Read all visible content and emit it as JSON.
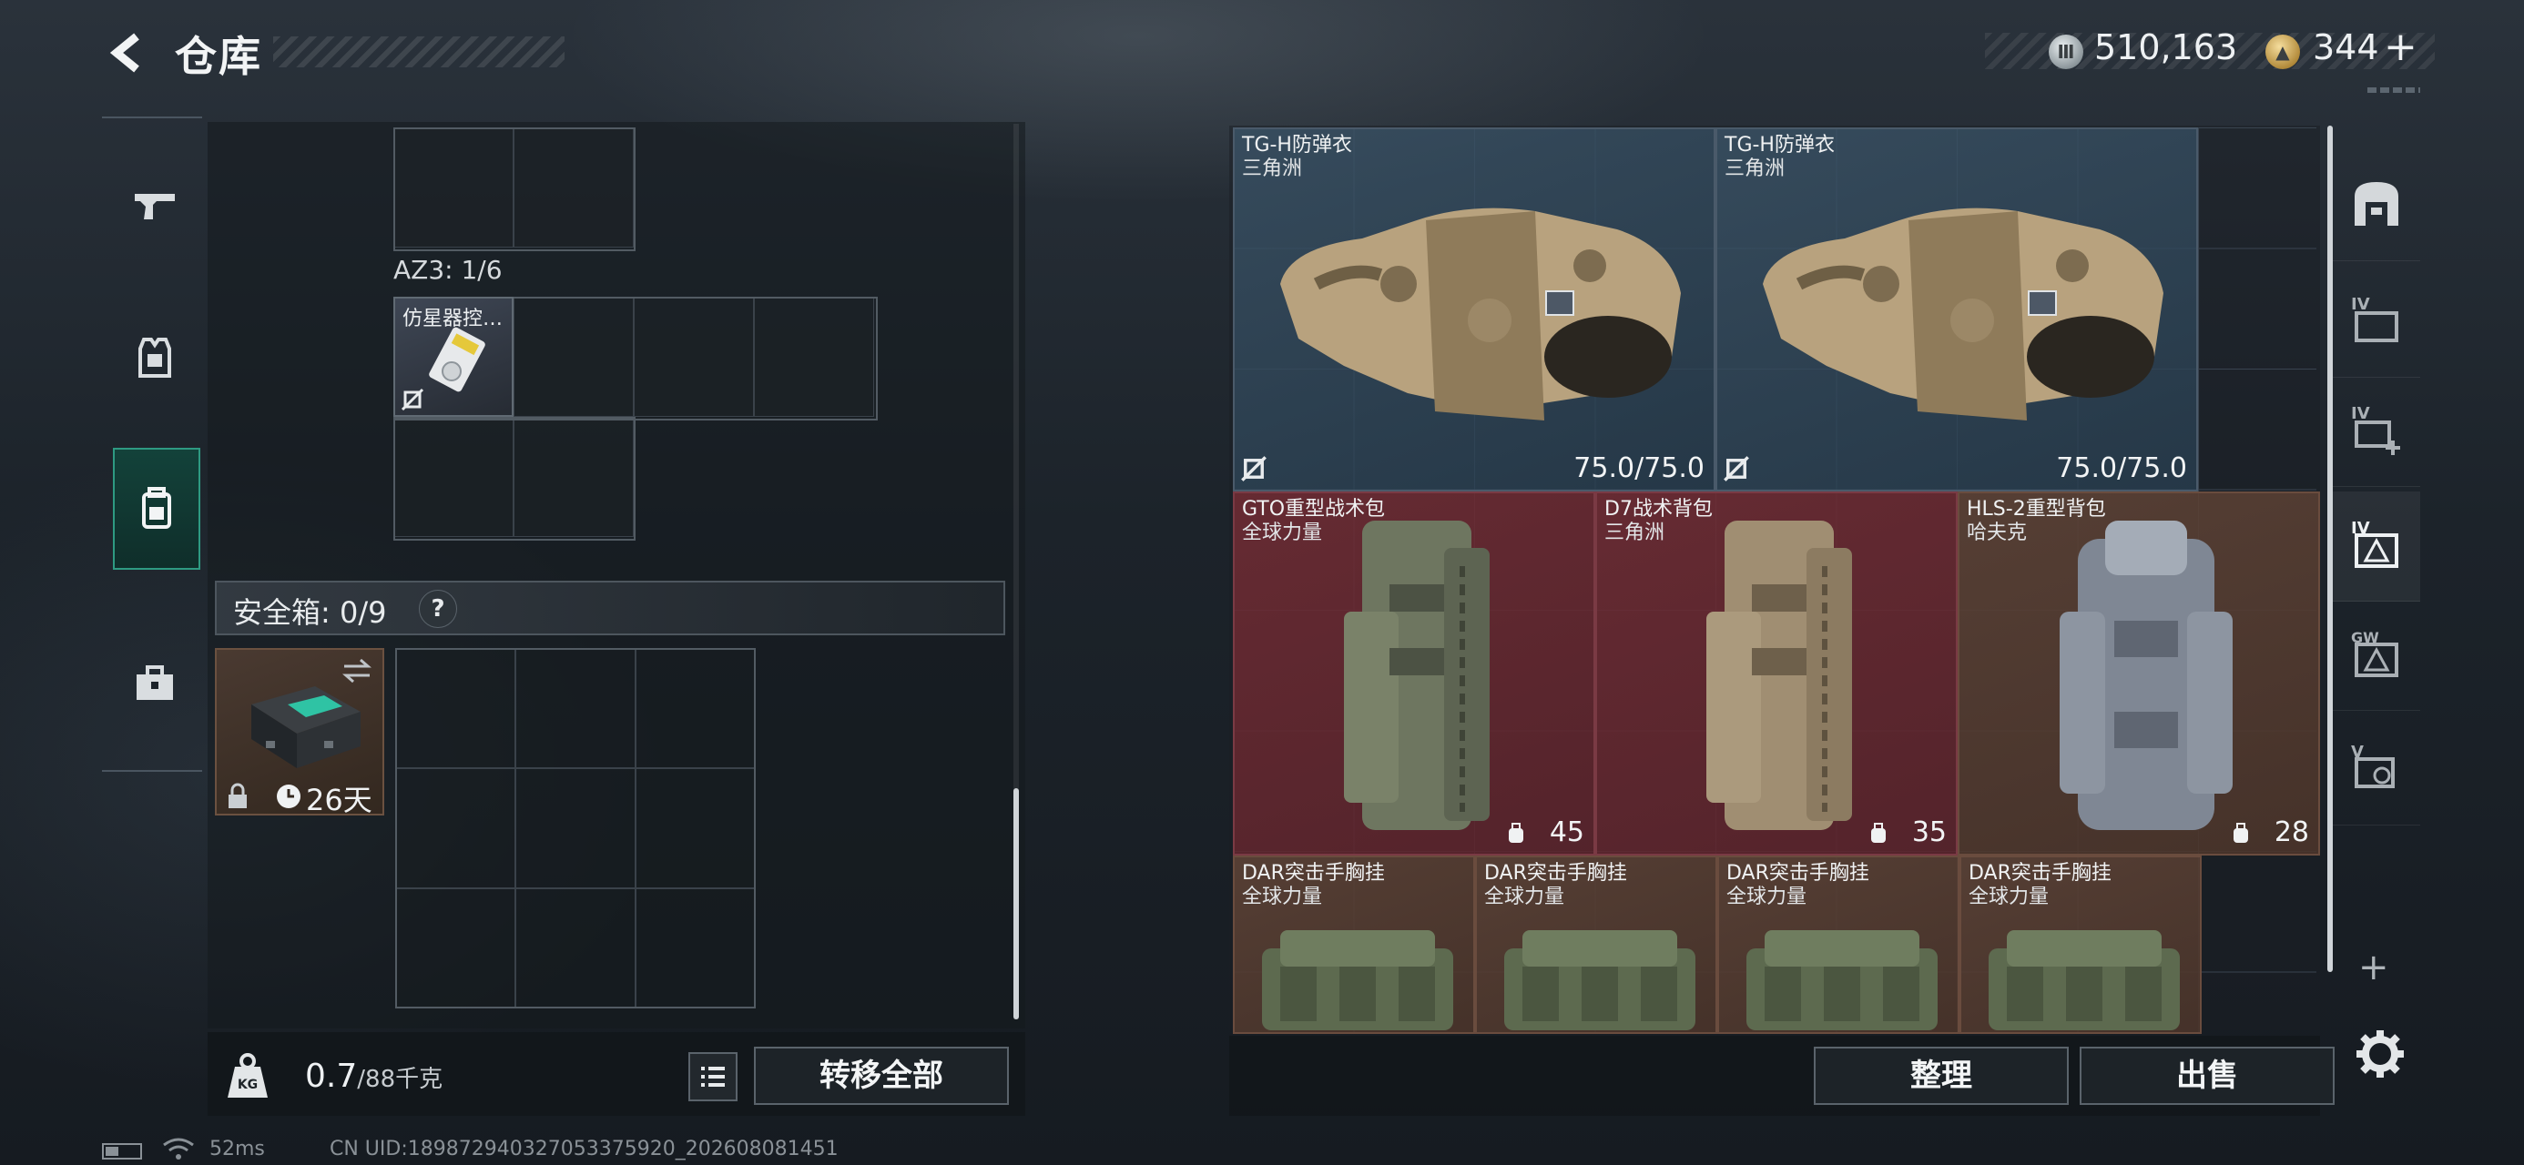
{
  "header": {
    "title": "仓库",
    "silver_amount": "510,163",
    "gold_amount": "344",
    "add_symbol": "+"
  },
  "left_tabs": [
    {
      "icon": "pistol-icon"
    },
    {
      "icon": "armor-vest-icon"
    },
    {
      "icon": "backpack-icon",
      "selected": true
    },
    {
      "icon": "toolbox-icon"
    }
  ],
  "storage": {
    "container_label": "AZ3: 1/6",
    "emulator_item_name": "仿星器控…"
  },
  "safebox": {
    "label": "安全箱: 0/9",
    "help": "?",
    "days": "26天"
  },
  "bottom_left": {
    "weight": "0.7",
    "capacity": "/88千克",
    "weight_icon_text": "KG",
    "transfer_all": "转移全部"
  },
  "stash_items": [
    {
      "name": "TG-H防弹衣",
      "brand": "三角洲",
      "durability": "75.0/75.0"
    },
    {
      "name": "TG-H防弹衣",
      "brand": "三角洲",
      "durability": "75.0/75.0"
    },
    {
      "name": "GTO重型战术包",
      "brand": "全球力量",
      "capacity": "45"
    },
    {
      "name": "D7战术背包",
      "brand": "三角洲",
      "capacity": "35"
    },
    {
      "name": "HLS-2重型背包",
      "brand": "哈夫克",
      "capacity": "28"
    },
    {
      "name": "DAR突击手胸挂",
      "brand": "全球力量"
    },
    {
      "name": "DAR突击手胸挂",
      "brand": "全球力量"
    },
    {
      "name": "DAR突击手胸挂",
      "brand": "全球力量"
    },
    {
      "name": "DAR突击手胸挂",
      "brand": "全球力量"
    }
  ],
  "bottom_right": {
    "sort": "整理",
    "sell": "出售"
  },
  "right_tabs": {
    "labels": [
      "IV",
      "IV",
      "IV",
      "GW",
      "V"
    ],
    "add": "+"
  },
  "status": {
    "ping": "52ms",
    "uid": "CN UID:1898729403270533759​20_202608081451"
  },
  "colors": {
    "accent": "#2e9a82",
    "red_rarity": "#702c34",
    "gold_rarity": "#5c4236",
    "blue_rarity": "#3c5569"
  }
}
